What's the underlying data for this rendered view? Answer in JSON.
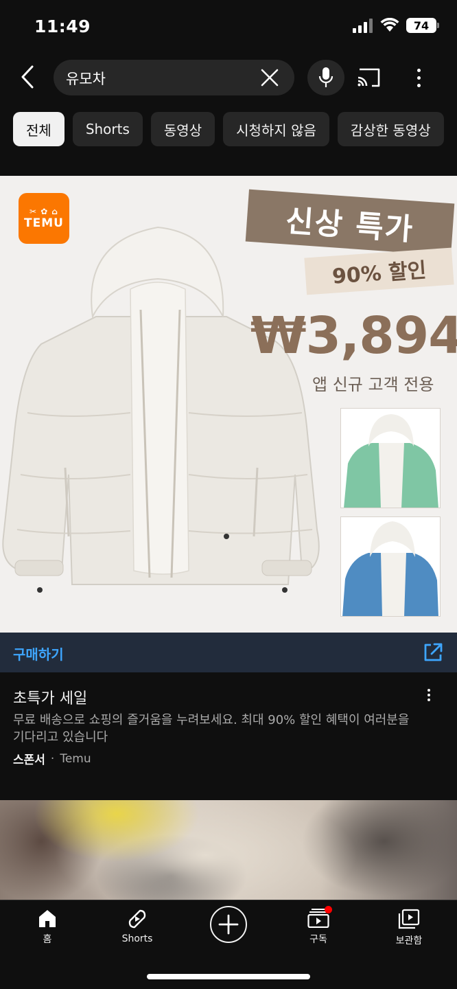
{
  "status_bar": {
    "time": "11:49",
    "battery": "74"
  },
  "search": {
    "query": "유모차"
  },
  "chips": [
    "전체",
    "Shorts",
    "동영상",
    "시청하지 않음",
    "감상한 동영상"
  ],
  "ad": {
    "brand_logo": "TEMU",
    "tag_new": "신상 특가",
    "tag_discount": "90% 할인",
    "price": "₩3,894",
    "price_note": "앱 신규 고객 전용",
    "buy_label": "구매하기",
    "title": "초특가 세일",
    "description": "무료 배송으로 쇼핑의 즐거움을 누려보세요. 최대 90% 할인 혜택이 여러분을 기다리고 있습니다",
    "sponsor_label": "스폰서",
    "separator": "·",
    "advertiser": "Temu"
  },
  "nav": {
    "home": "홈",
    "shorts": "Shorts",
    "subscriptions": "구독",
    "library": "보관함"
  },
  "colors": {
    "accent": "#3ea6ff",
    "temu": "#fb7701",
    "notification": "#ff0000"
  }
}
